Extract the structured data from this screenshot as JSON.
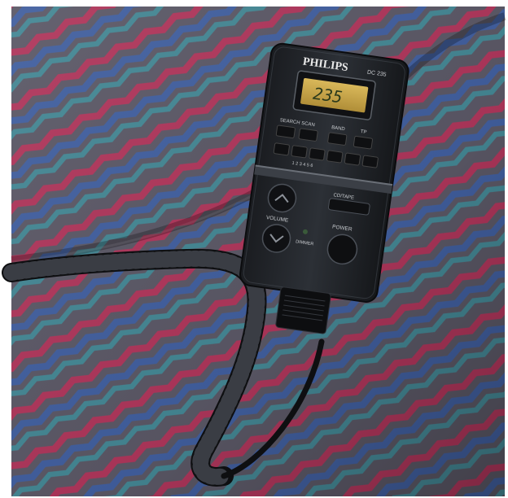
{
  "remote": {
    "brand": "PHILIPS",
    "model": "DC 235",
    "display": "235",
    "buttons": {
      "search_scan": "SEARCH SCAN",
      "band": "BAND",
      "tp": "TP",
      "row2": "1 2 3 4 5 6",
      "cd_tape": "CD/TAPE",
      "volume": "VOLUME",
      "power": "POWER",
      "dimmer": "DIMMER"
    }
  },
  "colors": {
    "fabric_base": "#5b5866",
    "stripe_red": "#b8325a",
    "stripe_blue": "#3e5fa6",
    "stripe_teal": "#3f8f9c",
    "device_body": "#23262b",
    "lcd_backlight": "#c9a64a"
  }
}
